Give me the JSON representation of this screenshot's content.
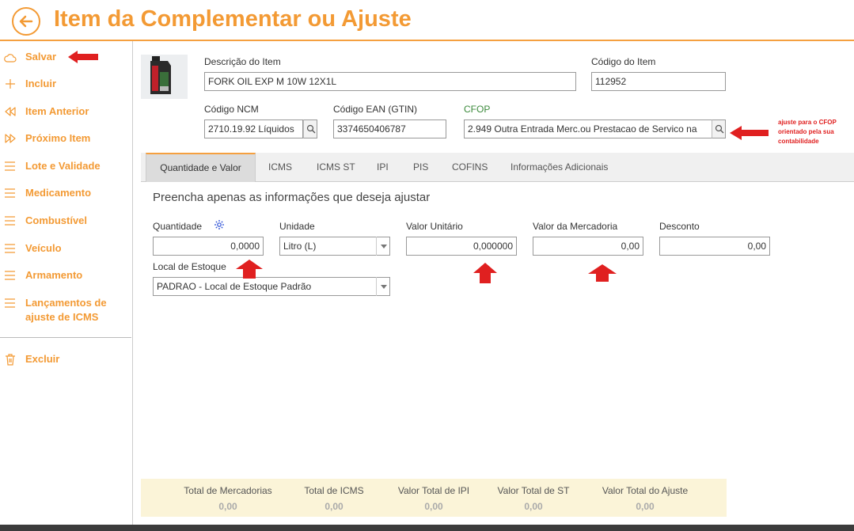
{
  "header": {
    "title": "Item da Complementar ou Ajuste",
    "back_icon": "arrow-left-circle-icon"
  },
  "sidebar": {
    "items": [
      {
        "label": "Salvar",
        "icon": "cloud-icon"
      },
      {
        "label": "Incluir",
        "icon": "plus-icon"
      },
      {
        "label": "Item Anterior",
        "icon": "rewind-icon"
      },
      {
        "label": "Próximo Item",
        "icon": "fast-forward-icon"
      },
      {
        "label": "Lote e Validade",
        "icon": "menu-icon"
      },
      {
        "label": "Medicamento",
        "icon": "menu-icon"
      },
      {
        "label": "Combustível",
        "icon": "menu-icon"
      },
      {
        "label": "Veículo",
        "icon": "menu-icon"
      },
      {
        "label": "Armamento",
        "icon": "menu-icon"
      },
      {
        "label": "Lançamentos de ajuste de ICMS",
        "icon": "menu-icon"
      },
      {
        "label": "Excluir",
        "icon": "trash-icon"
      }
    ]
  },
  "item": {
    "descricao_label": "Descrição do Item",
    "descricao_value": "FORK OIL EXP M 10W 12X1L",
    "codigo_label": "Código do Item",
    "codigo_value": "112952",
    "ncm_label": "Código NCM",
    "ncm_value": "2710.19.92   Líquidos",
    "ean_label": "Código EAN (GTIN)",
    "ean_value": "3374650406787",
    "cfop_label": "CFOP",
    "cfop_value": "2.949     Outra Entrada Merc.ou Prestacao de Servico na",
    "annotation": "ajuste para o CFOP orientado pela sua contabilidade"
  },
  "tabs": [
    {
      "label": "Quantidade e Valor"
    },
    {
      "label": "ICMS"
    },
    {
      "label": "ICMS ST"
    },
    {
      "label": "IPI"
    },
    {
      "label": "PIS"
    },
    {
      "label": "COFINS"
    },
    {
      "label": "Informações Adicionais"
    }
  ],
  "form": {
    "instructions": "Preencha apenas as informações que deseja ajustar",
    "quantidade_label": "Quantidade",
    "quantidade_value": "0,0000",
    "unidade_label": "Unidade",
    "unidade_value": "Litro (L)",
    "valor_unitario_label": "Valor Unitário",
    "valor_unitario_value": "0,000000",
    "valor_mercadoria_label": "Valor da Mercadoria",
    "valor_mercadoria_value": "0,00",
    "desconto_label": "Desconto",
    "desconto_value": "0,00",
    "local_estoque_label": "Local de Estoque",
    "local_estoque_value": "PADRAO - Local de Estoque Padrão"
  },
  "totals": [
    {
      "label": "Total de Mercadorias",
      "value": "0,00"
    },
    {
      "label": "Total de ICMS",
      "value": "0,00"
    },
    {
      "label": "Valor Total de IPI",
      "value": "0,00"
    },
    {
      "label": "Valor Total de ST",
      "value": "0,00"
    },
    {
      "label": "Valor Total do Ajuste",
      "value": "0,00"
    }
  ],
  "colors": {
    "accent": "#f39a34",
    "annotation": "#e02020",
    "cfop_label": "#3b8a3b",
    "totals_bg": "#fbf4d8"
  }
}
